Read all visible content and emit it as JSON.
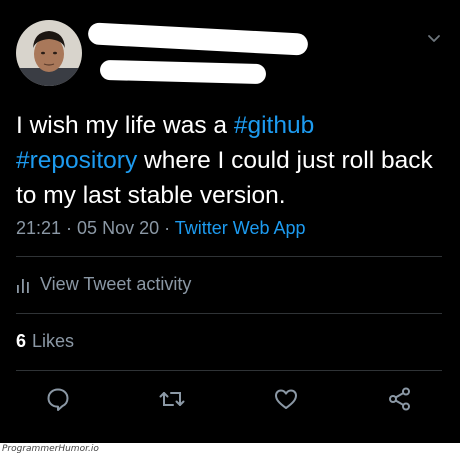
{
  "tweet": {
    "text_parts": [
      {
        "t": "I wish my life was a ",
        "tag": false
      },
      {
        "t": "#github",
        "tag": true
      },
      {
        "t": " ",
        "tag": false
      },
      {
        "t": "#repository",
        "tag": true
      },
      {
        "t": " where I could just roll back to my last stable version.",
        "tag": false
      }
    ],
    "time": "21:21",
    "separator": " · ",
    "date": "05 Nov 20",
    "app": "Twitter Web App"
  },
  "activity": {
    "label": "View Tweet activity"
  },
  "likes": {
    "count": "6",
    "label": "Likes"
  },
  "actions": [
    "reply-icon",
    "retweet-icon",
    "like-icon",
    "share-icon"
  ],
  "watermark": "ProgrammerHumor.io",
  "colors": {
    "background": "#000000",
    "text": "#ffffff",
    "muted": "#8b98a5",
    "accent": "#1d9bf0",
    "divider": "#2f3336"
  }
}
